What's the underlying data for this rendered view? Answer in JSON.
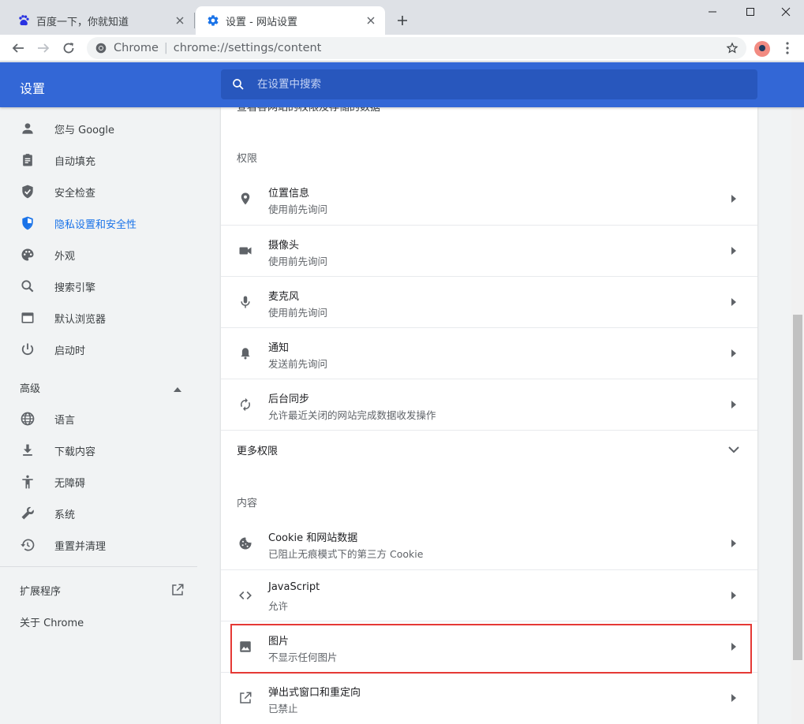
{
  "tabs": [
    {
      "title": "百度一下，你就知道",
      "active": false
    },
    {
      "title": "设置 - 网站设置",
      "active": true
    }
  ],
  "toolbar": {
    "url_origin": "Chrome",
    "url_path": "chrome://settings/content"
  },
  "header": {
    "title": "设置",
    "search_placeholder": "在设置中搜索"
  },
  "sidebar": {
    "items": [
      {
        "label": "您与 Google",
        "icon": "person-icon"
      },
      {
        "label": "自动填充",
        "icon": "clipboard-icon"
      },
      {
        "label": "安全检查",
        "icon": "shield-check-icon"
      },
      {
        "label": "隐私设置和安全性",
        "icon": "shield-icon"
      },
      {
        "label": "外观",
        "icon": "palette-icon"
      },
      {
        "label": "搜索引擎",
        "icon": "search-icon"
      },
      {
        "label": "默认浏览器",
        "icon": "browser-icon"
      },
      {
        "label": "启动时",
        "icon": "power-icon"
      }
    ],
    "advanced_label": "高级",
    "advanced_items": [
      {
        "label": "语言",
        "icon": "globe-icon"
      },
      {
        "label": "下载内容",
        "icon": "download-icon"
      },
      {
        "label": "无障碍",
        "icon": "accessibility-icon"
      },
      {
        "label": "系统",
        "icon": "wrench-icon"
      },
      {
        "label": "重置并清理",
        "icon": "restore-icon"
      }
    ],
    "extensions_label": "扩展程序",
    "about_label": "关于 Chrome"
  },
  "content": {
    "cut_text": "查看各网站的权限及存储的数据",
    "permissions_label": "权限",
    "permissions": [
      {
        "title": "位置信息",
        "subtitle": "使用前先询问",
        "icon": "location-icon"
      },
      {
        "title": "摄像头",
        "subtitle": "使用前先询问",
        "icon": "camera-icon"
      },
      {
        "title": "麦克风",
        "subtitle": "使用前先询问",
        "icon": "microphone-icon"
      },
      {
        "title": "通知",
        "subtitle": "发送前先询问",
        "icon": "bell-icon"
      },
      {
        "title": "后台同步",
        "subtitle": "允许最近关闭的网站完成数据收发操作",
        "icon": "sync-icon"
      }
    ],
    "more_permissions_label": "更多权限",
    "content_label": "内容",
    "content_items": [
      {
        "title": "Cookie 和网站数据",
        "subtitle": "已阻止无痕模式下的第三方 Cookie",
        "icon": "cookie-icon"
      },
      {
        "title": "JavaScript",
        "subtitle": "允许",
        "icon": "code-icon"
      },
      {
        "title": "图片",
        "subtitle": "不显示任何图片",
        "icon": "image-icon"
      },
      {
        "title": "弹出式窗口和重定向",
        "subtitle": "已禁止",
        "icon": "popup-icon"
      }
    ]
  },
  "colors": {
    "header": "#3367d6",
    "accent": "#1a73e8",
    "highlight": "#e53935"
  }
}
